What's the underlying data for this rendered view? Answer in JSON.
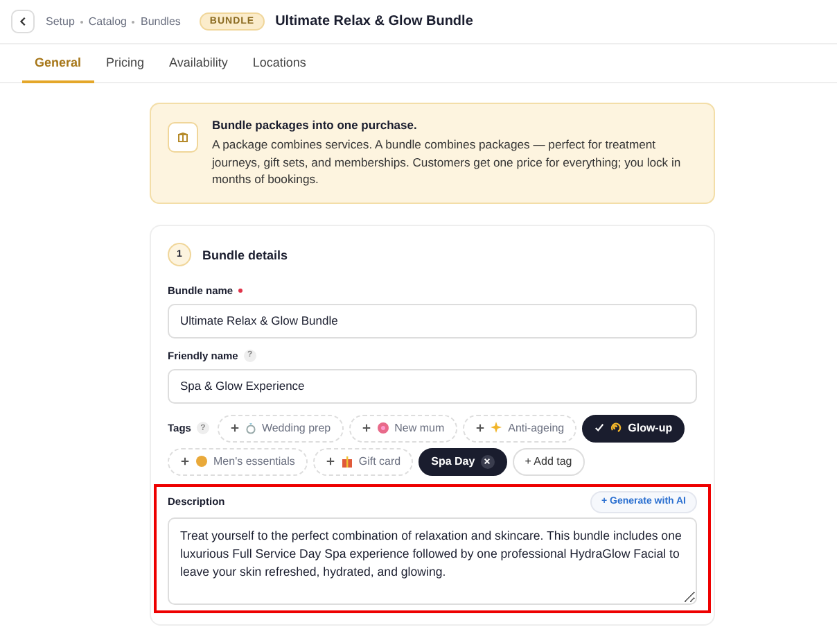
{
  "header": {
    "breadcrumb": [
      "Setup",
      "Catalog",
      "Bundles"
    ],
    "badge": "BUNDLE",
    "title": "Ultimate Relax & Glow Bundle"
  },
  "tabs": [
    {
      "label": "General",
      "selected": true
    },
    {
      "label": "Pricing",
      "selected": false
    },
    {
      "label": "Availability",
      "selected": false
    },
    {
      "label": "Locations",
      "selected": false
    }
  ],
  "notice": {
    "title": "Bundle packages into one purchase.",
    "body": "A package combines services. A bundle combines packages — perfect for treatment journeys, gift sets, and memberships. Customers get one price for everything; you lock in months of bookings."
  },
  "section": {
    "step": "1",
    "title": "Bundle details"
  },
  "fields": [
    {
      "label": "Bundle name",
      "required": true,
      "value": "Ultimate Relax & Glow Bundle"
    },
    {
      "label": "Friendly name",
      "required": false,
      "help": "?",
      "value": "Spa & Glow Experience"
    }
  ],
  "tags": {
    "label": "Tags",
    "help": "?",
    "items": [
      {
        "label": "Wedding prep",
        "kind": "preset",
        "selected": false
      },
      {
        "label": "New mum",
        "kind": "preset",
        "selected": false
      },
      {
        "label": "Anti-ageing",
        "kind": "preset",
        "selected": false
      },
      {
        "label": "Glow-up",
        "kind": "preset",
        "selected": true
      },
      {
        "label": "Men's essentials",
        "kind": "preset",
        "selected": false
      },
      {
        "label": "Gift card",
        "kind": "preset",
        "selected": false
      },
      {
        "label": "Spa Day",
        "kind": "custom",
        "selected": true
      }
    ],
    "add": "+ Add tag"
  },
  "description": {
    "label": "Description",
    "action": "+ Generate with AI",
    "highlighted": true,
    "value": "Treat yourself to the perfect combination of relaxation and skincare. This bundle includes one luxurious Full Service Day Spa experience followed by one professional HydraGlow Facial to leave your skin refreshed, hydrated, and glowing."
  }
}
